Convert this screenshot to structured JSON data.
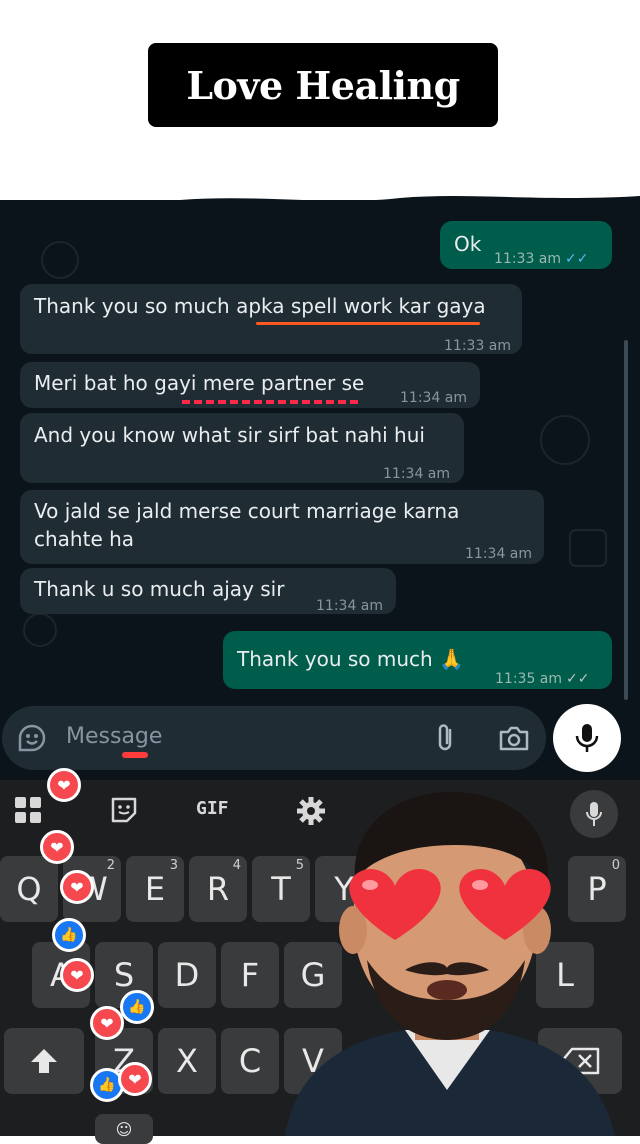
{
  "overlay_title": "Love Healing",
  "messages": [
    {
      "dir": "out",
      "text": "Ok",
      "time": "11:33 am"
    },
    {
      "dir": "in",
      "text": "Thank you so much apka spell work kar gaya",
      "time": "11:33 am"
    },
    {
      "dir": "in",
      "text": "Meri bat ho gayi mere partner se",
      "time": "11:34 am"
    },
    {
      "dir": "in",
      "text": "And you know what sir sirf bat nahi hui",
      "time": "11:34 am"
    },
    {
      "dir": "in",
      "text": "Vo jald se jald merse court marriage karna chahte ha",
      "time": "11:34 am"
    },
    {
      "dir": "in",
      "text": "Thank u so much ajay sir",
      "time": "11:34 am"
    },
    {
      "dir": "out",
      "text": "Thank you so much 🙏",
      "time": "11:35 am"
    }
  ],
  "composer": {
    "placeholder": "Message"
  },
  "keyboard": {
    "toolbar": [
      "apps-grid-icon",
      "sticker-icon",
      "GIF",
      "gear-icon",
      "mic-icon"
    ],
    "gif_label": "GIF",
    "row1": [
      {
        "key": "Q",
        "sup": ""
      },
      {
        "key": "W",
        "sup": "2"
      },
      {
        "key": "E",
        "sup": "3"
      },
      {
        "key": "R",
        "sup": "4"
      },
      {
        "key": "T",
        "sup": "5"
      },
      {
        "key": "Y",
        "sup": ""
      },
      {
        "key": "P",
        "sup": "0"
      }
    ],
    "row2": [
      "A",
      "S",
      "D",
      "F",
      "G",
      "L"
    ],
    "row3": [
      "Z",
      "X",
      "C",
      "V"
    ]
  },
  "colors": {
    "chat_bg": "#0b141a",
    "incoming_bubble": "#202c33",
    "outgoing_bubble": "#005c4b",
    "read_ticks": "#53bdeb",
    "underline_orange": "#ff5722",
    "underline_red": "#ff2a4a",
    "heart_reaction": "#f5484f",
    "like_reaction": "#1877f2"
  }
}
